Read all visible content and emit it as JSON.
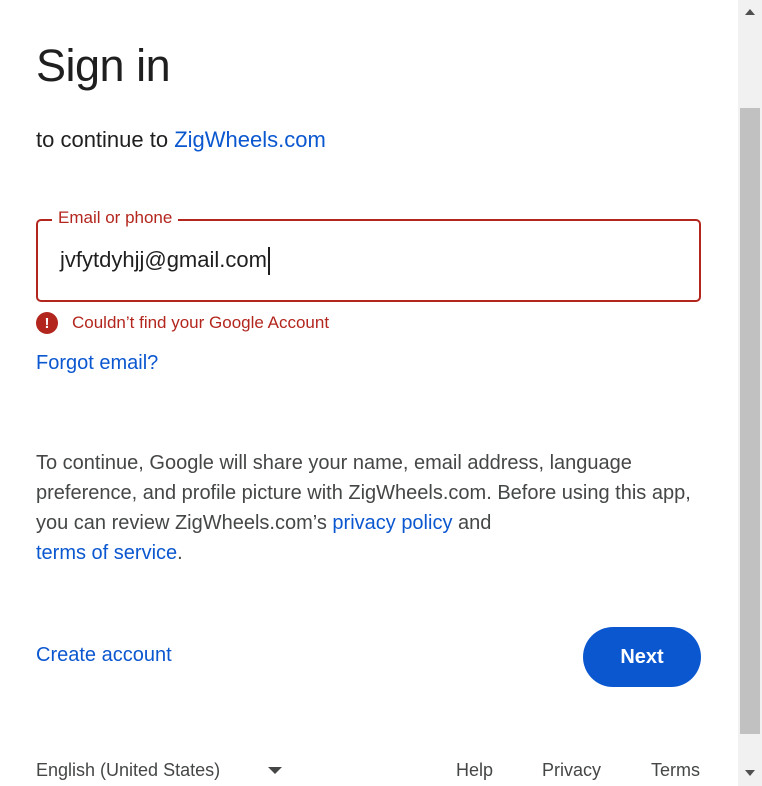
{
  "header": {
    "title": "Sign in",
    "subtitle_prefix": "to continue to ",
    "site_name": "ZigWheels.com"
  },
  "email_field": {
    "label": "Email or phone",
    "value": "jvfytdyhjj@gmail.com"
  },
  "error": {
    "icon": "!",
    "message": "Couldn’t find your Google Account"
  },
  "forgot_email": "Forgot email?",
  "disclaimer": {
    "text": "To continue, Google will share your name, email address, language preference, and profile picture with ZigWheels.com. Before using this app, you can review ZigWheels.com’s ",
    "privacy_link": "privacy policy",
    "and_text": " and ",
    "terms_link": "terms of service",
    "end": "."
  },
  "actions": {
    "create_account": "Create account",
    "next": "Next"
  },
  "footer": {
    "language": "English (United States)",
    "help": "Help",
    "privacy": "Privacy",
    "terms": "Terms"
  },
  "colors": {
    "accent": "#0b57d0",
    "error": "#b3261e",
    "text": "#1f1f1f",
    "muted": "#444746"
  },
  "icons": {
    "error": "error-circle-icon",
    "language_dropdown": "chevron-down-icon",
    "scroll_up": "scroll-up-arrow-icon",
    "scroll_down": "scroll-down-arrow-icon"
  }
}
